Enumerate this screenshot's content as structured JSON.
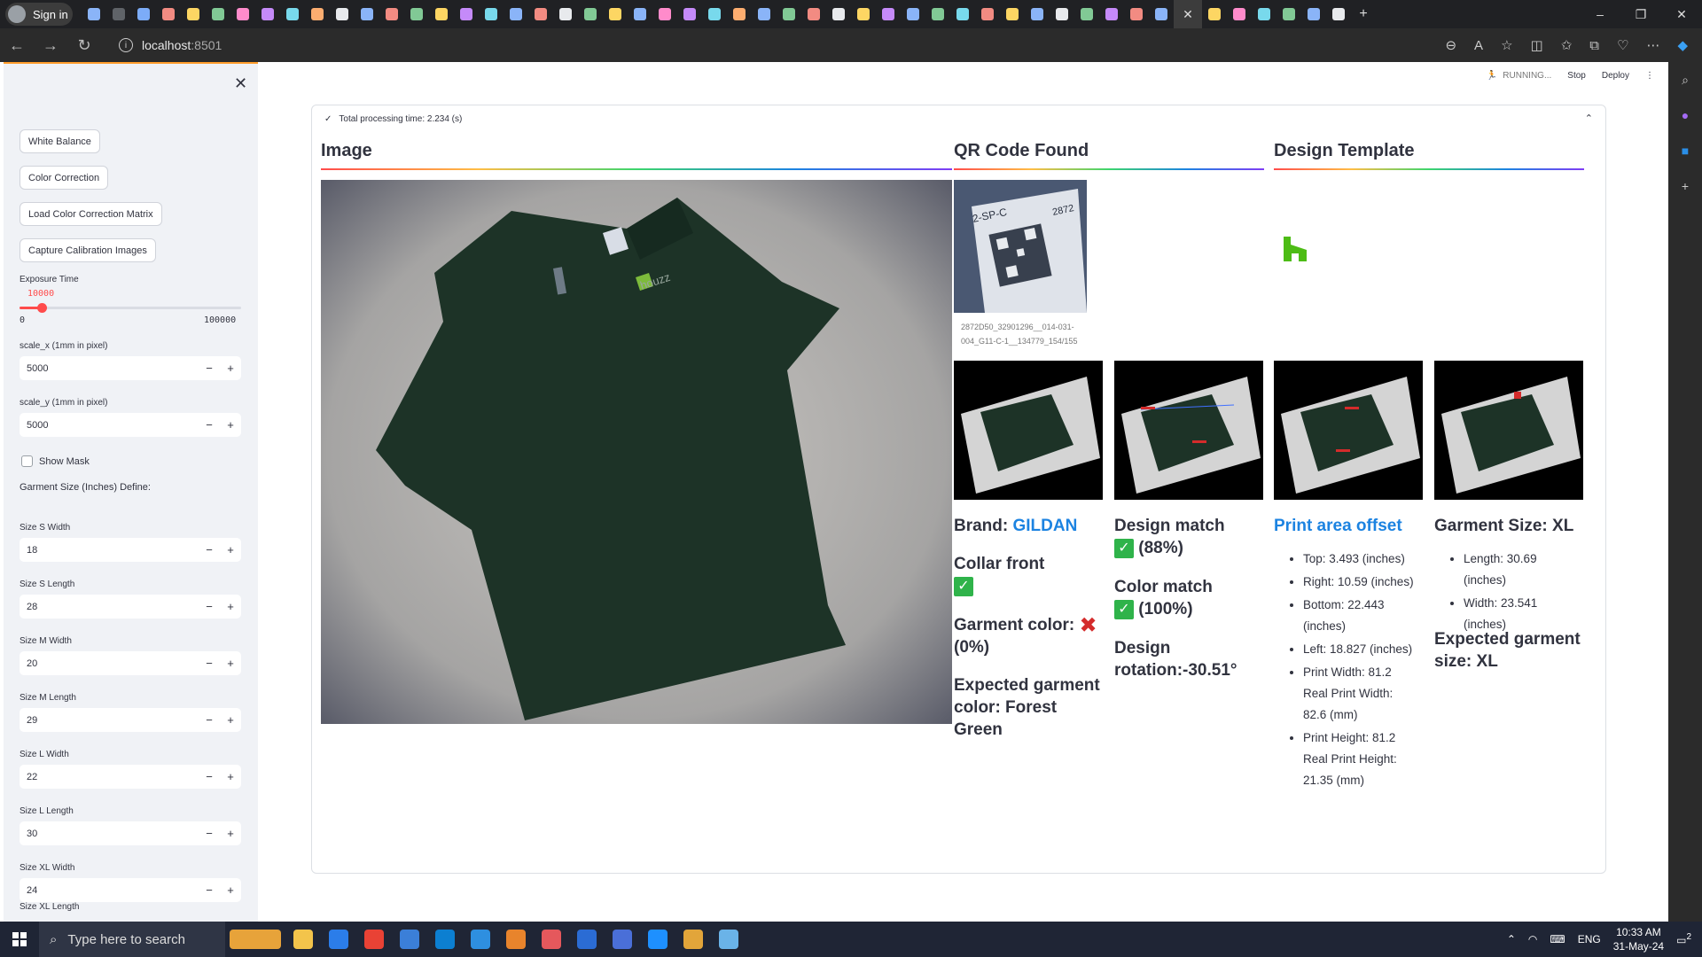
{
  "browser": {
    "signin_label": "Sign in",
    "url_host": "localhost",
    "url_port": ":8501",
    "tab_colors": [
      "#8ab4f8",
      "#5f6368",
      "#7cacf8",
      "#f28b82",
      "#fdd663",
      "#81c995",
      "#ff8bcb",
      "#c58af9",
      "#78d9ec",
      "#fcad70",
      "#e8eaed",
      "#8ab4f8",
      "#f28b82",
      "#81c995",
      "#fdd663",
      "#c58af9",
      "#78d9ec",
      "#8ab4f8",
      "#f28b82",
      "#e8eaed",
      "#81c995",
      "#fdd663",
      "#8ab4f8",
      "#ff8bcb",
      "#c58af9",
      "#78d9ec",
      "#fcad70",
      "#8ab4f8",
      "#81c995",
      "#f28b82",
      "#e8eaed",
      "#fdd663",
      "#c58af9",
      "#8ab4f8",
      "#81c995",
      "#78d9ec",
      "#f28b82",
      "#fdd663",
      "#8ab4f8",
      "#e8eaed",
      "#81c995",
      "#c58af9",
      "#f28b82",
      "#8ab4f8",
      "#fdd663",
      "#ff8bcb",
      "#78d9ec",
      "#81c995",
      "#8ab4f8",
      "#e8eaed"
    ]
  },
  "sidebar": {
    "buttons": [
      "White Balance",
      "Color Correction",
      "Load Color Correction Matrix",
      "Capture Calibration Images"
    ],
    "exposure": {
      "label": "Exposure Time",
      "value": "10000",
      "min": "0",
      "max": "100000",
      "fraction": 0.1
    },
    "scale_x": {
      "label": "scale_x (1mm in pixel)",
      "value": "5000"
    },
    "scale_y": {
      "label": "scale_y (1mm in pixel)",
      "value": "5000"
    },
    "show_mask": "Show Mask",
    "garment_define": "Garment Size (Inches) Define:",
    "sizes": [
      {
        "label": "Size S Width",
        "value": "18"
      },
      {
        "label": "Size S Length",
        "value": "28"
      },
      {
        "label": "Size M Width",
        "value": "20"
      },
      {
        "label": "Size M Length",
        "value": "29"
      },
      {
        "label": "Size L Width",
        "value": "22"
      },
      {
        "label": "Size L Length",
        "value": "30"
      },
      {
        "label": "Size XL Width",
        "value": "24"
      }
    ],
    "last_label": "Size XL Length"
  },
  "header": {
    "running": "RUNNING...",
    "stop": "Stop",
    "deploy": "Deploy"
  },
  "expander": {
    "title": "Total processing time: 2.234 (s)"
  },
  "columns": {
    "image": "Image",
    "qr": "QR Code Found",
    "design": "Design Template"
  },
  "qr_caption": "2872D50_32901296__014-031-004_G11-C-1__134779_154/155",
  "results": {
    "brand_label": "Brand: ",
    "brand_value": "GILDAN",
    "collar": "Collar front",
    "garment_color": "Garment color:",
    "garment_color_pct": "(0%)",
    "expected_color": "Expected garment color: Forest Green",
    "design_match": "Design match",
    "design_match_pct": "(88%)",
    "color_match": "Color match",
    "color_match_pct": "(100%)",
    "design_rotation": "Design rotation:-30.51°",
    "print_offset_title": "Print area offset",
    "print_offset": [
      "Top: 3.493 (inches)",
      "Right: 10.59 (inches)",
      "Bottom: 22.443 (inches)",
      "Left: 18.827 (inches)",
      "Print Width: 81.2 Real Print Width: 82.6 (mm)",
      "Print Height: 81.2 Real Print Height: 21.35 (mm)"
    ],
    "garment_size_title": "Garment Size: XL",
    "garment_size": [
      "Length: 30.69 (inches)",
      "Width: 23.541 (inches)"
    ],
    "expected_size": "Expected garment size: XL"
  },
  "taskbar": {
    "search_placeholder": "Type here to search",
    "lang": "ENG",
    "time": "10:33 AM",
    "date": "31-May-24",
    "notifications": "2"
  }
}
